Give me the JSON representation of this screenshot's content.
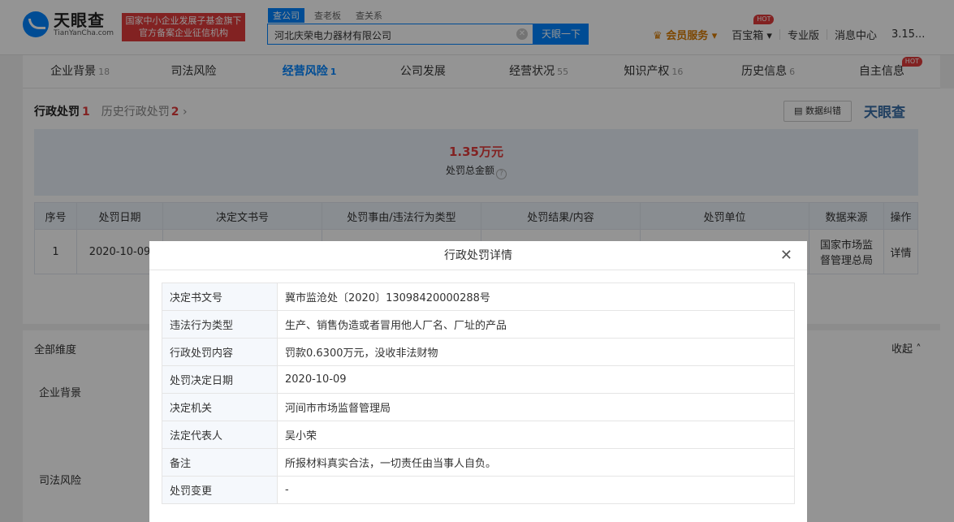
{
  "header": {
    "logo_cn": "天眼查",
    "logo_en": "TianYanCha.com",
    "gov_line1": "国家中小企业发展子基金旗下",
    "gov_line2": "官方备案企业征信机构",
    "search_tabs": [
      "查公司",
      "查老板",
      "查关系"
    ],
    "search_value": "河北庆荣电力器材有限公司",
    "search_button": "天眼一下",
    "vip": "会员服务",
    "nav": [
      "百宝箱",
      "专业版",
      "消息中心",
      "3.15..."
    ],
    "hot": "HOT"
  },
  "tabs": [
    {
      "label": "企业背景",
      "count": "18"
    },
    {
      "label": "司法风险",
      "count": ""
    },
    {
      "label": "经营风险",
      "count": "1"
    },
    {
      "label": "公司发展",
      "count": ""
    },
    {
      "label": "经营状况",
      "count": "55"
    },
    {
      "label": "知识产权",
      "count": "16"
    },
    {
      "label": "历史信息",
      "count": "6"
    },
    {
      "label": "自主信息",
      "count": ""
    }
  ],
  "subtabs": {
    "current": "行政处罚",
    "current_count": "1",
    "history": "历史行政处罚",
    "history_count": "2"
  },
  "data_correction": "数据纠错",
  "brand": "天眼查",
  "summary": {
    "amount": "1.35万元",
    "label": "处罚总金额"
  },
  "table": {
    "headers": [
      "序号",
      "处罚日期",
      "决定文书号",
      "处罚事由/违法行为类型",
      "处罚结果/内容",
      "处罚单位",
      "数据来源",
      "操作"
    ],
    "row": {
      "index": "1",
      "date": "2020-10-09",
      "source_line1": "国家市场监",
      "source_line2": "督管理总局",
      "action": "详情"
    }
  },
  "section2": {
    "title": "全部维度",
    "collapse": "收起",
    "row1_label": "企业背景",
    "row2_label": "司法风险"
  },
  "modal": {
    "title": "行政处罚详情",
    "rows": [
      {
        "key": "决定书文号",
        "value": "冀市监沧处〔2020〕13098420000288号"
      },
      {
        "key": "违法行为类型",
        "value": "生产、销售伪造或者冒用他人厂名、厂址的产品"
      },
      {
        "key": "行政处罚内容",
        "value": "罚款0.6300万元，没收非法财物"
      },
      {
        "key": "处罚决定日期",
        "value": "2020-10-09"
      },
      {
        "key": "决定机关",
        "value": "河间市市场监督管理局"
      },
      {
        "key": "法定代表人",
        "value": "吴小荣"
      },
      {
        "key": "备注",
        "value": "所报材料真实合法，一切责任由当事人自负。"
      },
      {
        "key": "处罚变更",
        "value": "-"
      }
    ]
  }
}
